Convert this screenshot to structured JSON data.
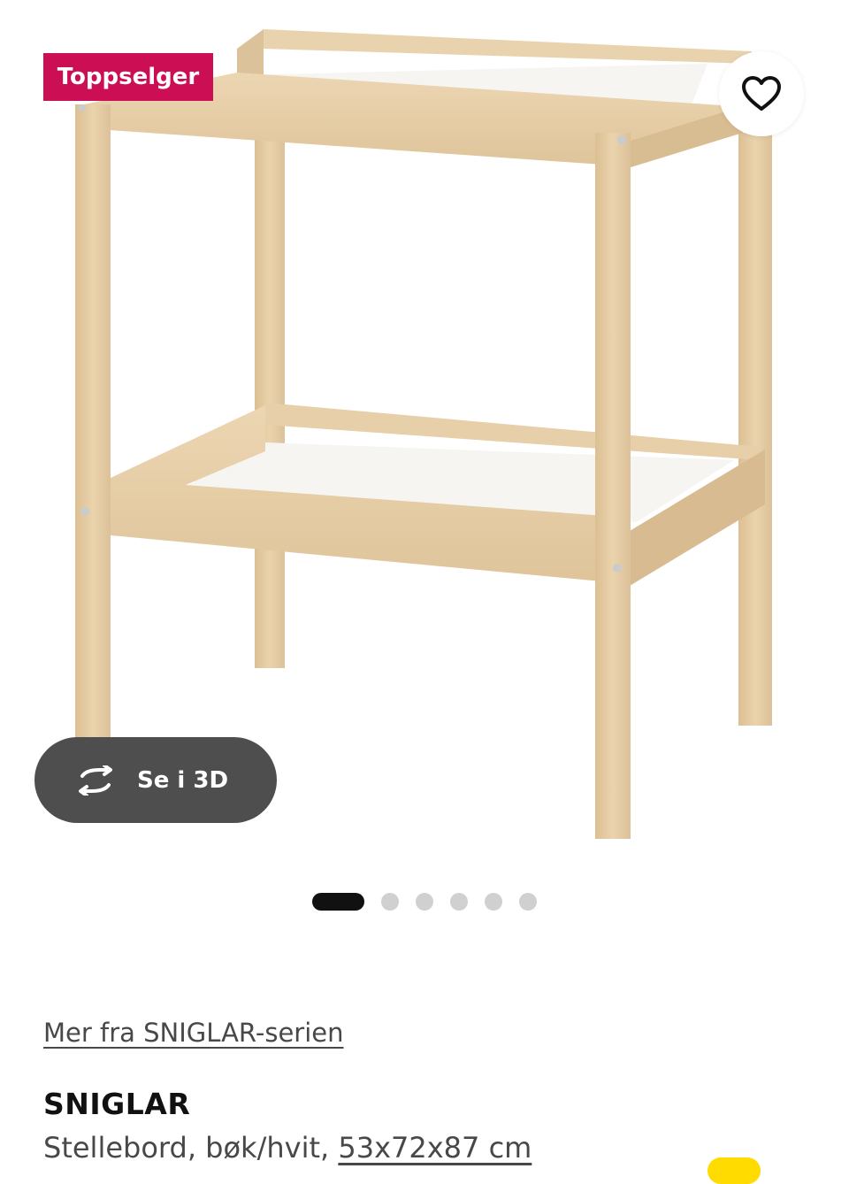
{
  "badge": {
    "label": "Toppselger",
    "color": "#cc0e54"
  },
  "favorite": {
    "icon": "heart-icon"
  },
  "view3d": {
    "label": "Se i 3D",
    "icon": "rotate-3d-icon"
  },
  "carousel": {
    "total": 6,
    "active_index": 0
  },
  "series_link": {
    "label": "Mer fra SNIGLAR-serien"
  },
  "product": {
    "name": "SNIGLAR",
    "description": "Stellebord, bøk/hvit,",
    "dimensions": "53x72x87 cm"
  },
  "colors": {
    "accent": "#ffdb00",
    "text": "#111111",
    "muted_text": "#484848",
    "pill": "#4e4e4e"
  }
}
